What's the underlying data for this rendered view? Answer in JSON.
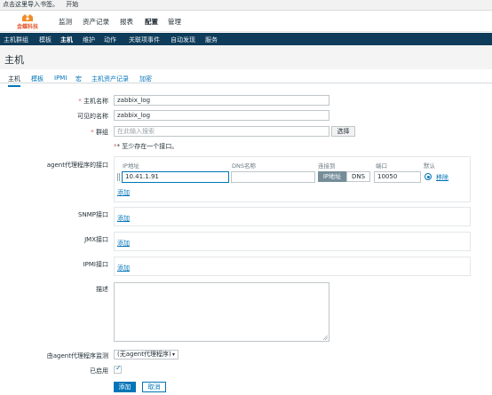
{
  "bookmark_bar": {
    "text": "点击这里导入书签。",
    "start_link": "开始"
  },
  "logo": {
    "text": "金蝶科技"
  },
  "top_nav": {
    "items": [
      "监测",
      "资产记录",
      "报表",
      "配置",
      "管理"
    ],
    "active": "配置"
  },
  "sub_nav": {
    "items": [
      "主机群组",
      "模板",
      "主机",
      "维护",
      "动作",
      "关联项事件",
      "自动发现",
      "服务"
    ],
    "active": "主机"
  },
  "page": {
    "title": "主机"
  },
  "tabs": {
    "items": [
      "主机",
      "模板",
      "IPMI",
      "宏",
      "主机资产记录",
      "加密"
    ],
    "active": "主机"
  },
  "form": {
    "host_name": {
      "label": "主机名称",
      "value": "zabbix_log"
    },
    "visible_name": {
      "label": "可见的名称",
      "value": "zabbix_log"
    },
    "groups": {
      "label": "群组",
      "placeholder": "在此输入搜索",
      "select_button": "选择"
    },
    "interface_hint": "* 至少存在一个接口。",
    "agent_interfaces": {
      "label": "agent代理程序的接口",
      "columns": {
        "ip": "IP地址",
        "dns": "DNS名称",
        "connect": "连接到",
        "port": "端口",
        "default": "默认"
      },
      "row": {
        "ip": "10.41.1.91",
        "dns": "",
        "connect_ip": "IP地址",
        "connect_dns": "DNS",
        "port": "10050",
        "remove": "移除"
      },
      "add": "添加"
    },
    "snmp": {
      "label": "SNMP接口",
      "add": "添加"
    },
    "jmx": {
      "label": "JMX接口",
      "add": "添加"
    },
    "ipmi": {
      "label": "IPMI接口",
      "add": "添加"
    },
    "description": {
      "label": "描述",
      "value": ""
    },
    "proxy": {
      "label": "由agent代理程序监测",
      "value": "(无agent代理程序)"
    },
    "enabled": {
      "label": "已启用",
      "checked": true
    },
    "buttons": {
      "add": "添加",
      "cancel": "取消"
    }
  },
  "colors": {
    "accent": "#0275b8",
    "subnav": "#0e3c5a",
    "required": "#e45959"
  }
}
